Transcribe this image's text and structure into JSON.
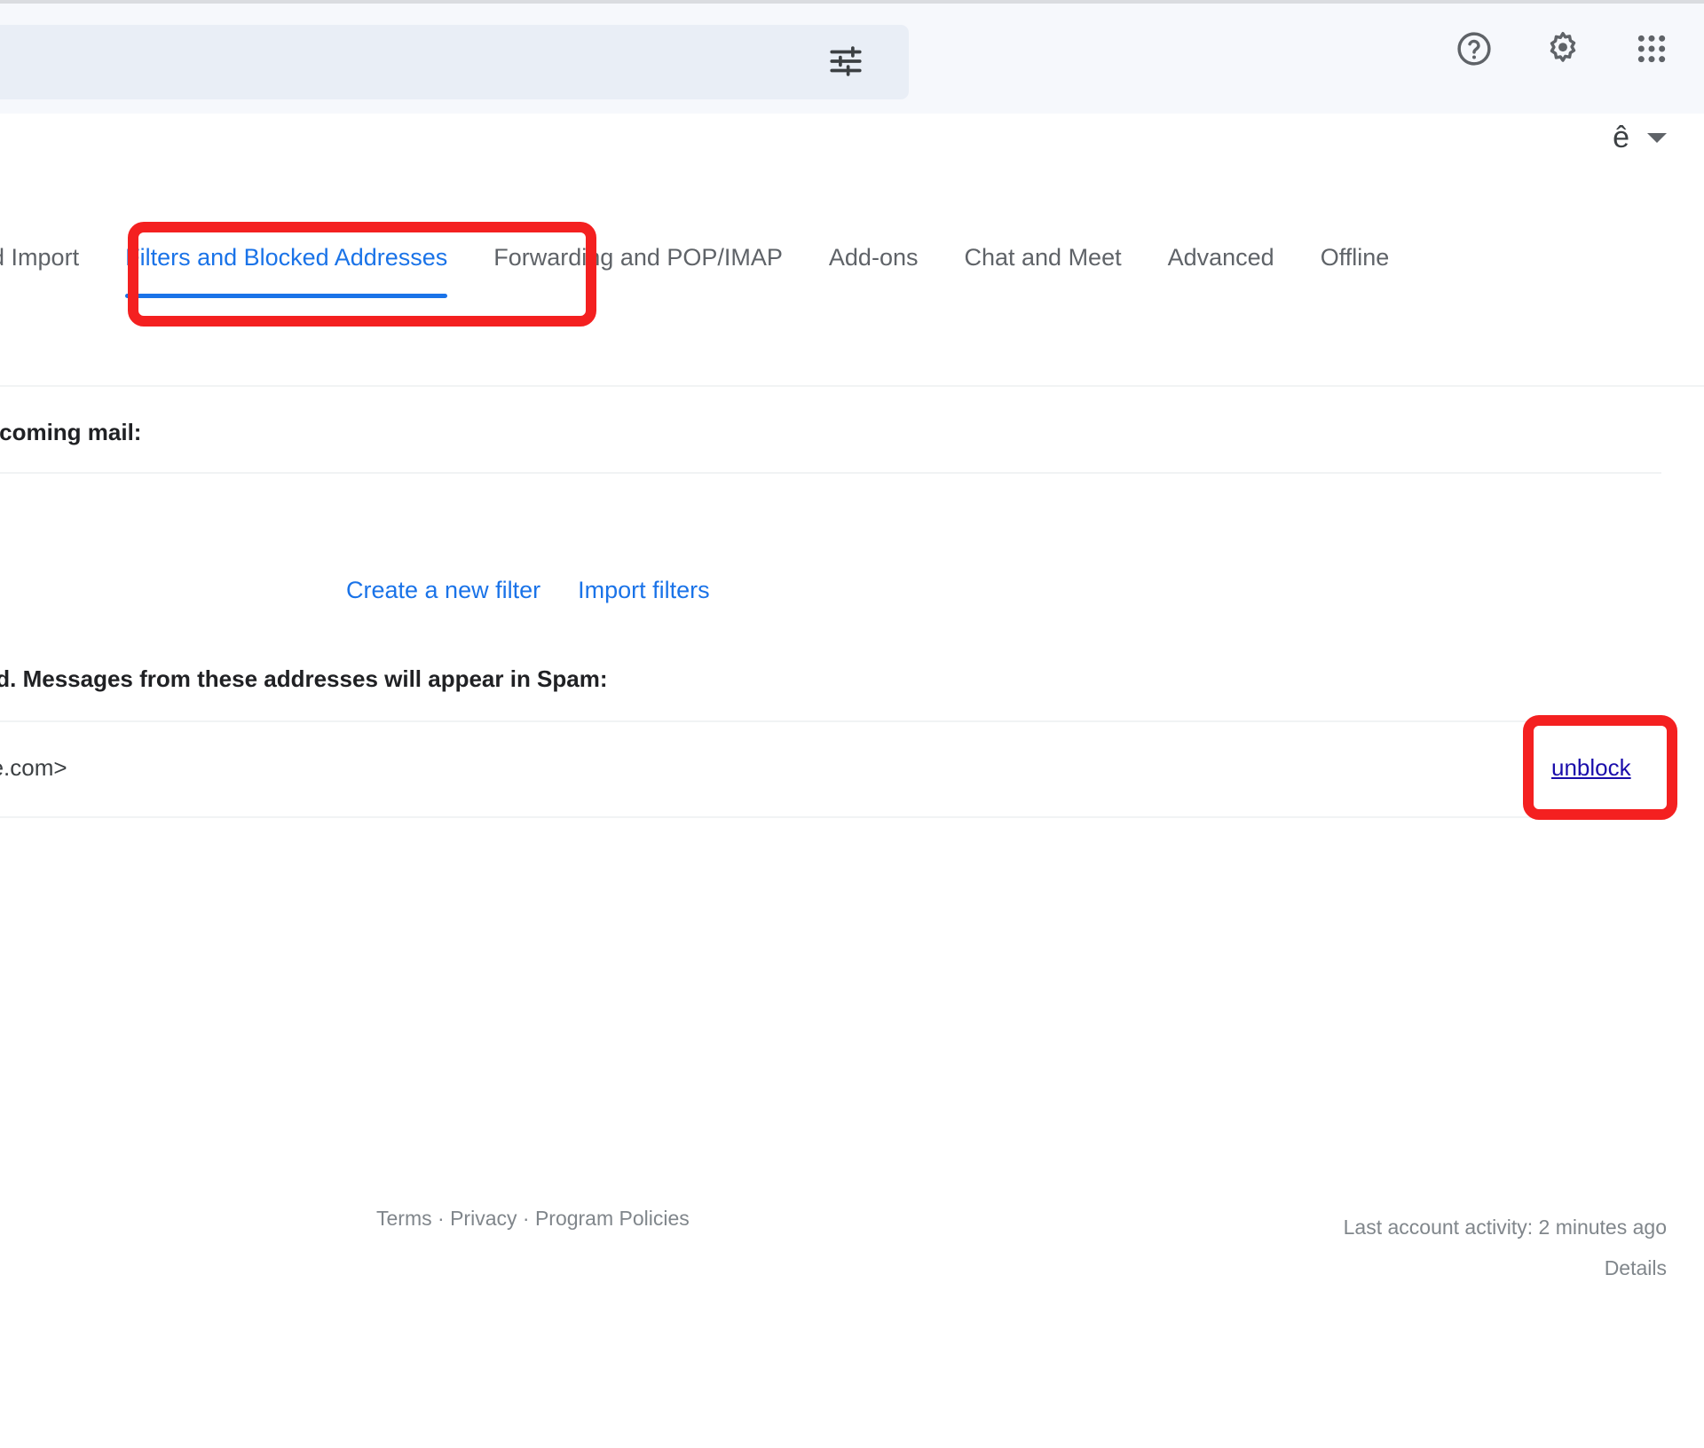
{
  "topbar": {
    "search_pill_label": "",
    "tune_icon": "tune-icon",
    "help_icon": "help-circle-icon",
    "settings_icon": "gear-icon",
    "apps_icon": "apps-grid-icon"
  },
  "locale": {
    "glyph": "ê",
    "caret": "dropdown-caret-icon"
  },
  "tabs": [
    {
      "label": "and Import",
      "active": false,
      "truncated": true
    },
    {
      "label": "Filters and Blocked Addresses",
      "active": true
    },
    {
      "label": "Forwarding and POP/IMAP",
      "active": false
    },
    {
      "label": "Add-ons",
      "active": false
    },
    {
      "label": "Chat and Meet",
      "active": false
    },
    {
      "label": "Advanced",
      "active": false
    },
    {
      "label": "Offline",
      "active": false
    }
  ],
  "content": {
    "filters_heading": "incoming mail:",
    "create_filter_link": "Create a new filter",
    "import_filters_link": "Import filters",
    "blocked_heading": "ocked. Messages from these addresses will appear in Spam:",
    "blocked_rows": [
      {
        "address": "hare.com>",
        "action_label": "unblock"
      }
    ]
  },
  "footer": {
    "terms": "Terms",
    "sep1": " · ",
    "privacy": "Privacy",
    "sep2": " · ",
    "program_policies": "Program Policies",
    "last_activity": "Last account activity: 2 minutes ago",
    "details": "Details"
  },
  "annotations": {
    "color": "#f42020",
    "targets": [
      "tab-filters-and-blocked-addresses",
      "unblock-link"
    ]
  }
}
